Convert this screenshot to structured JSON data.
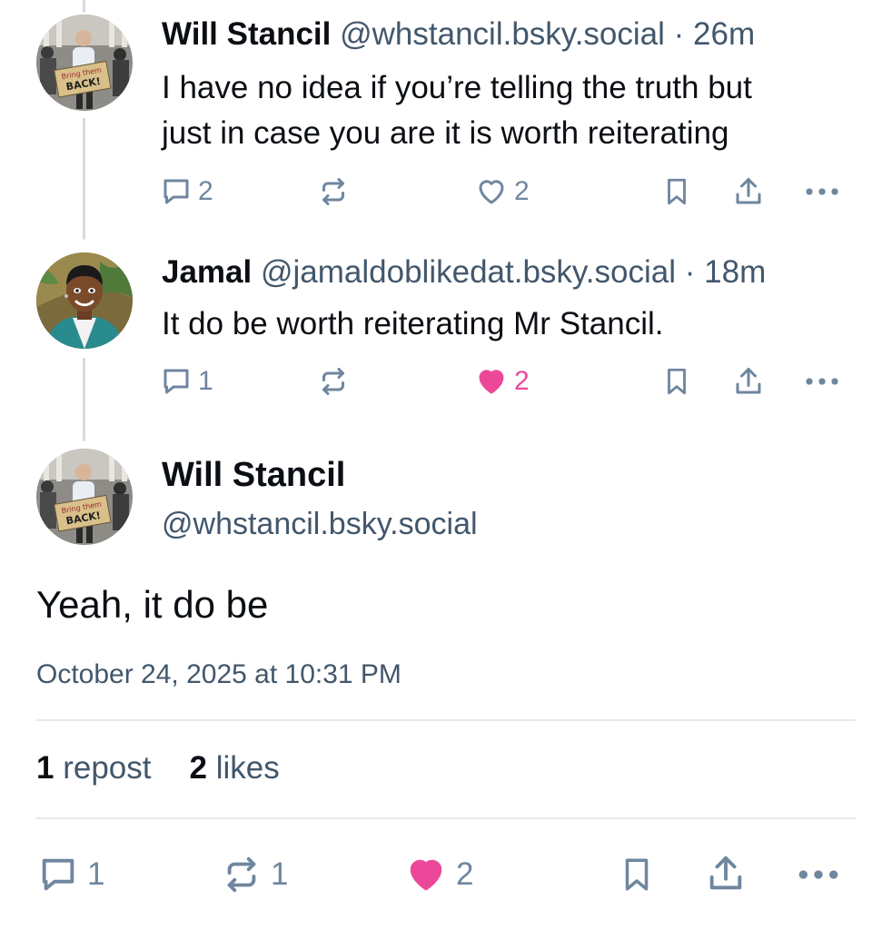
{
  "posts": [
    {
      "name": "Will Stancil",
      "handle": "@whstancil.bsky.social",
      "time": "26m",
      "text_line1": "I have no idea if you’re telling the truth  but",
      "text_line2": "just in case you are it is worth reiterating",
      "replies": "2",
      "reposts": "",
      "likes": "2",
      "liked": false,
      "avatar_sign_top": "Bring them",
      "avatar_sign_bottom": "BACK!"
    },
    {
      "name": "Jamal",
      "handle": "@jamaldoblikedat.bsky.social",
      "time": "18m",
      "text_line1": "It do be worth reiterating Mr Stancil.",
      "replies": "1",
      "reposts": "",
      "likes": "2",
      "liked": true
    }
  ],
  "main_post": {
    "name": "Will Stancil",
    "handle": "@whstancil.bsky.social",
    "text": "Yeah, it do be",
    "date": "October 24, 2025 at 10:31 PM",
    "repost_count": "1",
    "repost_label": "repost",
    "like_count": "2",
    "like_label": "likes",
    "replies": "1",
    "reposts": "1",
    "likes": "2",
    "avatar_sign_top": "Bring them",
    "avatar_sign_bottom": "BACK!"
  },
  "meta_separator": " · ",
  "colors": {
    "like_pink": "#ec4899",
    "muted": "#6f869f",
    "handle": "#42576c"
  }
}
